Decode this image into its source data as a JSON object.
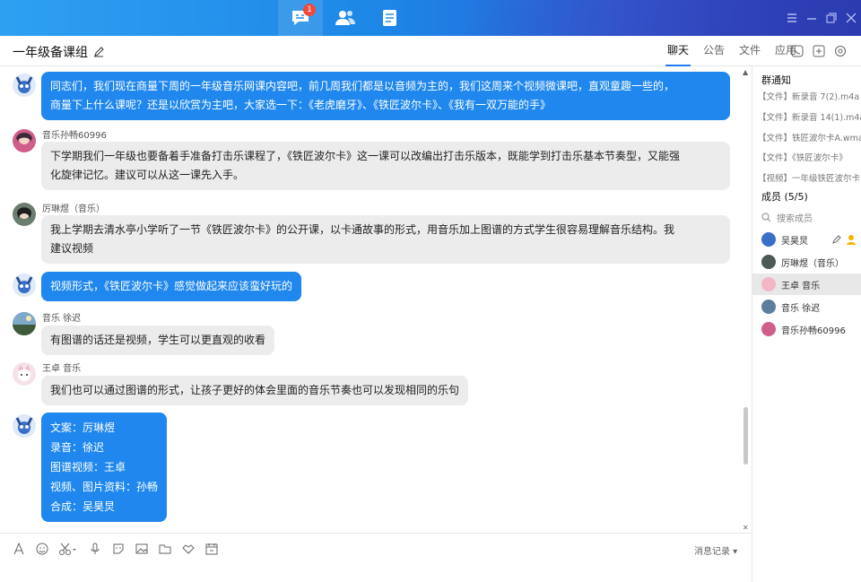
{
  "topbar": {
    "badge_count": "1",
    "nav": [
      "chat-icon",
      "contacts-icon",
      "docs-icon"
    ],
    "window_controls": [
      "menu-icon",
      "minimize-icon",
      "restore-icon",
      "close-icon"
    ]
  },
  "header": {
    "group_name": "一年级备课组",
    "tabs": [
      "聊天",
      "公告",
      "文件",
      "应用"
    ],
    "active_tab": "聊天"
  },
  "messages": [
    {
      "sender": "",
      "type": "self",
      "lines": [
        "同志们，我们现在商量下周的一年级音乐网课内容吧，前几周我们都是以音频为主的，我们这周来个视频微课吧，直观童趣一些的，",
        "商量下上什么课呢？还是以欣赏为主吧，大家选一下：《老虎磨牙》、《铁匠波尔卡》、《我有一双万能的手》"
      ]
    },
    {
      "sender": "音乐孙畅60996",
      "type": "other",
      "lines": [
        "下学期我们一年级也要备着手准备打击乐课程了，《铁匠波尔卡》这一课可以改编出打击乐版本，既能学到打击乐基本节奏型，又能强",
        "化旋律记忆。建议可以从这一课先入手。"
      ]
    },
    {
      "sender": "厉琳煜（音乐）",
      "type": "other",
      "lines": [
        "我上学期去清水亭小学听了一节《铁匠波尔卡》的公开课，以卡通故事的形式，用音乐加上图谱的方式学生很容易理解音乐结构。我",
        "建议视频"
      ]
    },
    {
      "sender": "",
      "type": "self",
      "lines": [
        "视频形式，《铁匠波尔卡》感觉做起来应该蛮好玩的"
      ]
    },
    {
      "sender": "音乐 徐迟",
      "type": "other",
      "lines": [
        "有图谱的话还是视频，学生可以更直观的收看"
      ]
    },
    {
      "sender": "王卓 音乐",
      "type": "other",
      "lines": [
        "我们也可以通过图谱的形式，让孩子更好的体会里面的音乐节奏也可以发现相同的乐句"
      ]
    },
    {
      "sender": "",
      "type": "self",
      "lines": [
        "文案：厉琳煜",
        "录音：徐迟",
        "图谱视频：王卓",
        "视频、图片资料：孙畅",
        "合成：吴昊炅"
      ]
    }
  ],
  "composer": {
    "tools": [
      "font-icon",
      "emoji-icon",
      "scissors-icon",
      "mic-icon",
      "sticker-icon",
      "image-icon",
      "folder-icon",
      "handshake-icon",
      "calendar-icon"
    ],
    "history_label": "消息记录 ▾"
  },
  "panel": {
    "notice_title": "群通知",
    "notices": [
      "【文件】新录音 7(2).m4a",
      "【文件】新录音 14(1).m4a",
      "【文件】铁匠波尔卡A.wma",
      "【文件】《铁匠波尔卡》",
      "【视频】一年级铁匠波尔卡"
    ],
    "members_title": "成员 (5/5)",
    "search_placeholder": "搜索成员",
    "members": [
      "吴昊炅",
      "厉琳煜（音乐）",
      "王卓 音乐",
      "音乐 徐迟",
      "音乐孙畅60996"
    ]
  }
}
